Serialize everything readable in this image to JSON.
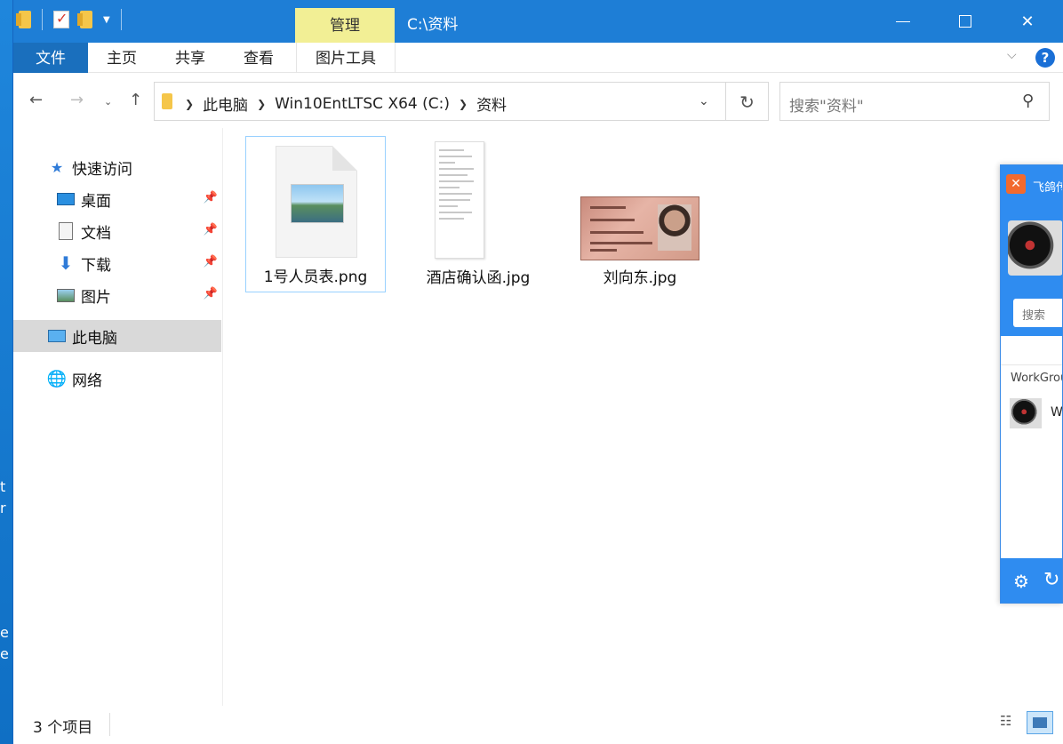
{
  "desktop_edge": {
    "chars": [
      "t",
      "r",
      "e",
      "e"
    ]
  },
  "titlebar": {
    "manage_tab": "管理",
    "title": "C:\\资料",
    "minimize": "—",
    "maximize": "☐",
    "close": "✕"
  },
  "ribbon": {
    "file": "文件",
    "home": "主页",
    "share": "共享",
    "view": "查看",
    "picture_tools": "图片工具",
    "help": "?"
  },
  "address": {
    "crumbs": [
      "此电脑",
      "Win10EntLTSC X64 (C:)",
      "资料"
    ],
    "search_placeholder": "搜索\"资料\""
  },
  "sidebar": {
    "quick_access": "快速访问",
    "desktop": "桌面",
    "documents": "文档",
    "downloads": "下载",
    "pictures": "图片",
    "this_pc": "此电脑",
    "network": "网络"
  },
  "files": [
    {
      "name": "1号人员表.png"
    },
    {
      "name": "酒店确认函.jpg"
    },
    {
      "name": "刘向东.jpg"
    }
  ],
  "status": {
    "items": "3 个项目"
  },
  "sideapp": {
    "title": "飞鸽传",
    "search": "搜索",
    "group": "WorkGroup",
    "item": "W"
  }
}
